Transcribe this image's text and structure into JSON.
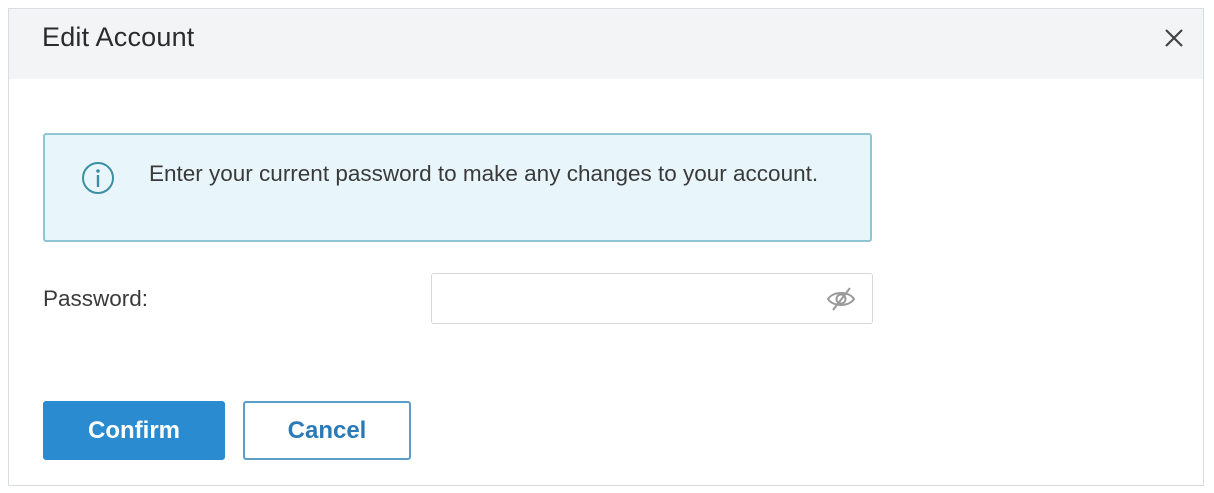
{
  "dialog": {
    "title": "Edit Account",
    "close_icon": "close-icon"
  },
  "info": {
    "icon": "info-icon",
    "message": "Enter your current password to make any changes to your account."
  },
  "password": {
    "label": "Password:",
    "value": "",
    "placeholder": "",
    "visibility_icon": "eye-slash-icon"
  },
  "actions": {
    "confirm_label": "Confirm",
    "cancel_label": "Cancel"
  },
  "colors": {
    "accent": "#2a8bd0",
    "info_bg": "#e8f6fb",
    "info_border": "#8ec6d3",
    "header_bg": "#f2f4f6"
  }
}
